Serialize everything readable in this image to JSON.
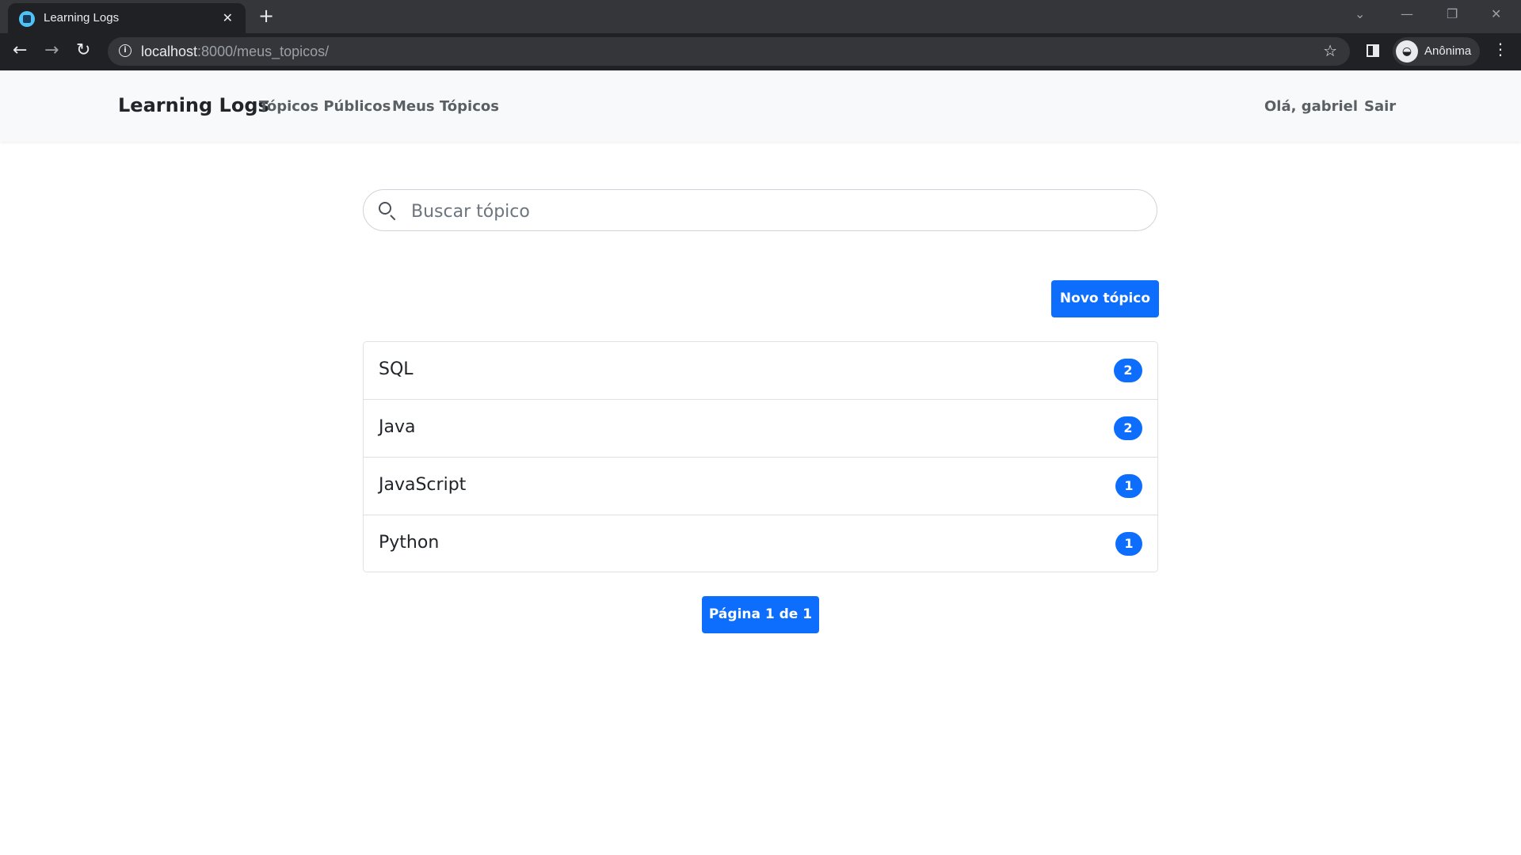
{
  "browser": {
    "tab_title": "Learning Logs",
    "url_host": "localhost",
    "url_path": ":8000/meus_topicos/",
    "profile_label": "Anônima",
    "new_tab_symbol": "+",
    "close_symbol": "✕"
  },
  "navbar": {
    "brand": "Learning Logs",
    "links": [
      "Tópicos Públicos",
      "Meus Tópicos"
    ],
    "greeting": "Olá, gabriel",
    "logout": "Sair"
  },
  "search": {
    "placeholder": "Buscar tópico"
  },
  "new_topic_button": "Novo tópico",
  "topics": [
    {
      "name": "SQL",
      "count": "2"
    },
    {
      "name": "Java",
      "count": "2"
    },
    {
      "name": "JavaScript",
      "count": "1"
    },
    {
      "name": "Python",
      "count": "1"
    }
  ],
  "pagination": "Página 1 de 1",
  "colors": {
    "primary": "#0d6efd",
    "navbar_bg": "#f8f9fa",
    "chrome_dark": "#202124"
  }
}
